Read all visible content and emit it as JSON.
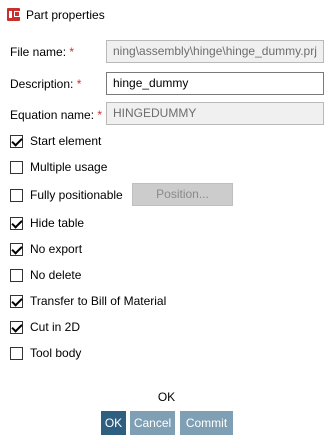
{
  "window": {
    "title": "Part properties",
    "icon": "app-icon"
  },
  "fields": {
    "file_name": {
      "label": "File name:",
      "value": "C:\\ning\\assembly\\hinge\\hinge_dummy.prj",
      "display": "ning\\assembly\\hinge\\hinge_dummy.prj"
    },
    "description": {
      "label": "Description:",
      "value": "hinge_dummy"
    },
    "equation_name": {
      "label": "Equation name:",
      "value": "HINGEDUMMY"
    },
    "required_marker": "*"
  },
  "checkboxes": [
    {
      "label": "Start element",
      "checked": true
    },
    {
      "label": "Multiple usage",
      "checked": false
    },
    {
      "label": "Fully positionable",
      "checked": false
    },
    {
      "label": "Hide table",
      "checked": true
    },
    {
      "label": "No export",
      "checked": true
    },
    {
      "label": "No delete",
      "checked": false
    },
    {
      "label": "Transfer to Bill of Material",
      "checked": true
    },
    {
      "label": "Cut in 2D",
      "checked": true
    },
    {
      "label": "Tool body",
      "checked": false
    }
  ],
  "position_button": {
    "label": "Position..."
  },
  "footer": {
    "caption": "OK",
    "ok_label": "OK",
    "cancel_label": "Cancel",
    "commit_label": "Commit"
  },
  "colors": {
    "accent": "#2f5f80",
    "accent_light": "#7f9fb4",
    "required": "#c8302f"
  }
}
